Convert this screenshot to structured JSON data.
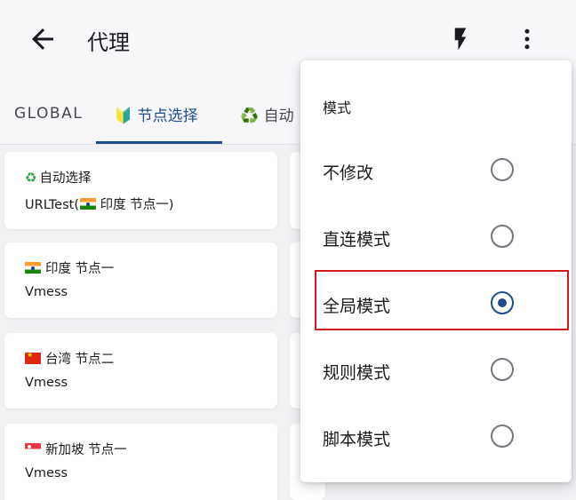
{
  "appbar": {
    "title": "代理"
  },
  "tabs": [
    {
      "label": "GLOBAL"
    },
    {
      "icon": "🔰",
      "label": "节点选择"
    },
    {
      "icon": "♻️",
      "label": "自动"
    }
  ],
  "cards": [
    {
      "icon": "recycle",
      "name": "自动选择",
      "type_prefix": "URLTest(",
      "type_flag": "india",
      "type_suffix": " 印度 节点一)"
    },
    {
      "flag": "india",
      "name": "印度 节点一",
      "type": "Vmess"
    },
    {
      "flag": "china",
      "name": "台湾 节点二",
      "type": "Vmess"
    },
    {
      "flag": "singapore",
      "name": "新加坡 节点一",
      "type": "Vmess"
    }
  ],
  "menu": {
    "title": "模式",
    "options": [
      {
        "label": "不修改",
        "selected": false
      },
      {
        "label": "直连模式",
        "selected": false
      },
      {
        "label": "全局模式",
        "selected": true
      },
      {
        "label": "规则模式",
        "selected": false
      },
      {
        "label": "脚本模式",
        "selected": false
      }
    ]
  },
  "colors": {
    "accent": "#1d4e89",
    "highlight": "#d11a1a",
    "background": "#f1f1f4"
  }
}
